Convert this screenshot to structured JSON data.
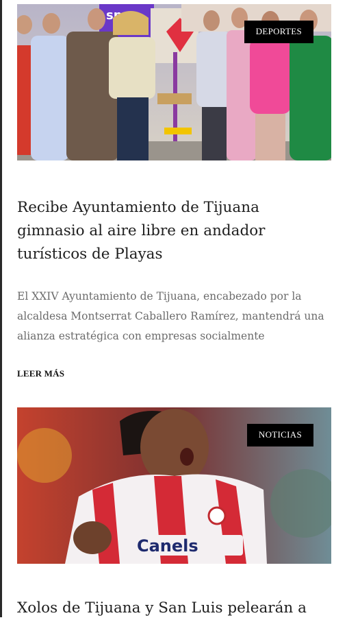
{
  "articles": [
    {
      "category": "DEPORTES",
      "title": "Recibe Ayuntamiento de Tijuana gimnasio al aire libre en andador turísticos de Playas",
      "excerpt": "El XXIV Ayuntamiento de Tijuana, encabezado por la alcaldesa Montserrat Caballero Ramírez, mantendrá una alianza estratégica con empresas socialmente",
      "read_more": "LEER MÁS",
      "image_text": "spo"
    },
    {
      "category": "NOTICIAS",
      "title": "Xolos de Tijuana y San Luis pelearán a",
      "jersey_sponsor": "Canels"
    }
  ]
}
